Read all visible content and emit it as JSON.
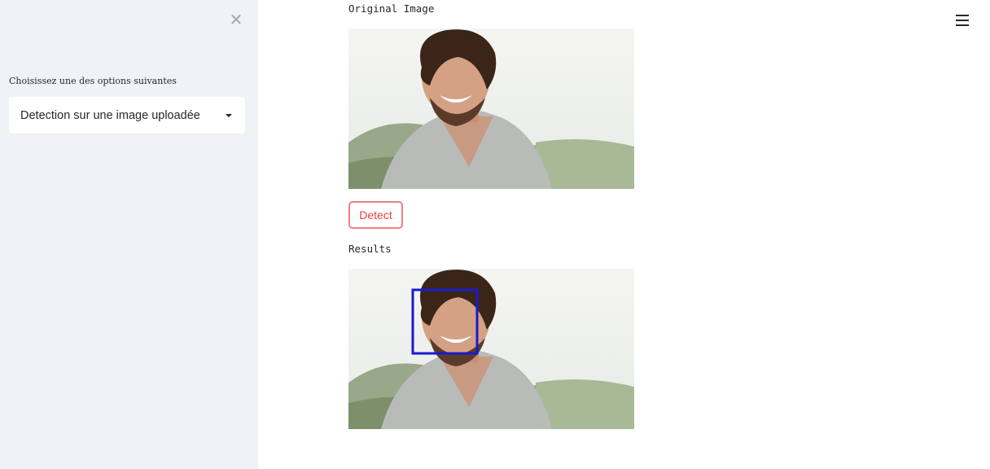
{
  "sidebar": {
    "close_icon": "close-icon",
    "select_label": "Choisissez une des options suivantes",
    "select_value": "Detection sur une image uploadée"
  },
  "header": {
    "menu_icon": "hamburger-menu-icon"
  },
  "main": {
    "original_label": "Original Image",
    "detect_label": "Detect",
    "results_label": "Results"
  },
  "colors": {
    "sidebar_bg": "#f0f2f6",
    "detect_border": "#f08080",
    "detect_text": "#f04040",
    "box_color": "#1a1acc"
  }
}
